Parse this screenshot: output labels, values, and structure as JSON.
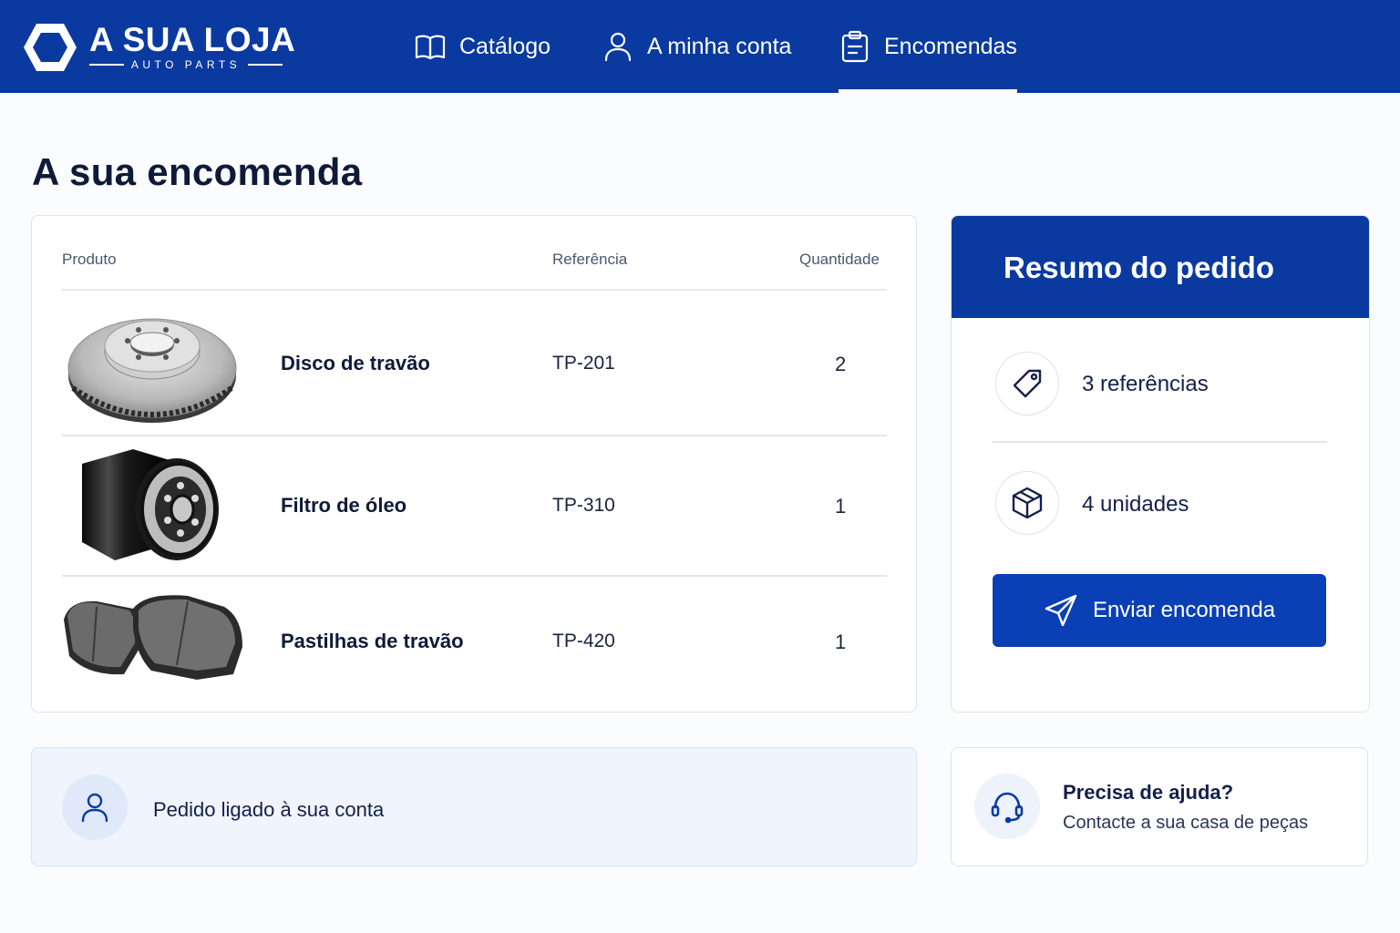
{
  "brand": {
    "title": "A SUA LOJA",
    "subtitle": "AUTO PARTS"
  },
  "nav": {
    "items": [
      {
        "label": "Catálogo",
        "icon": "book-icon"
      },
      {
        "label": "A minha conta",
        "icon": "user-icon"
      },
      {
        "label": "Encomendas",
        "icon": "clipboard-icon",
        "active": true
      }
    ]
  },
  "page": {
    "title": "A sua encomenda"
  },
  "order": {
    "columns": [
      "Produto",
      "Referência",
      "Quantidade"
    ],
    "rows": [
      {
        "name": "Disco de travão",
        "ref": "TP-201",
        "qty": "2",
        "image": "brake-disc"
      },
      {
        "name": "Filtro de óleo",
        "ref": "TP-310",
        "qty": "1",
        "image": "oil-filter"
      },
      {
        "name": "Pastilhas de travão",
        "ref": "TP-420",
        "qty": "1",
        "image": "brake-pads"
      }
    ]
  },
  "summary": {
    "title": "Resumo do pedido",
    "references": "3 referências",
    "units": "4 unidades",
    "send_label": "Enviar encomenda"
  },
  "linked": {
    "text": "Pedido ligado à sua conta"
  },
  "help": {
    "title": "Precisa de ajuda?",
    "subtitle": "Contacte a sua casa de peças"
  },
  "colors": {
    "brand_blue": "#0a3aa0",
    "button_blue": "#0a3fb5",
    "text_dark": "#0f1a3a"
  }
}
